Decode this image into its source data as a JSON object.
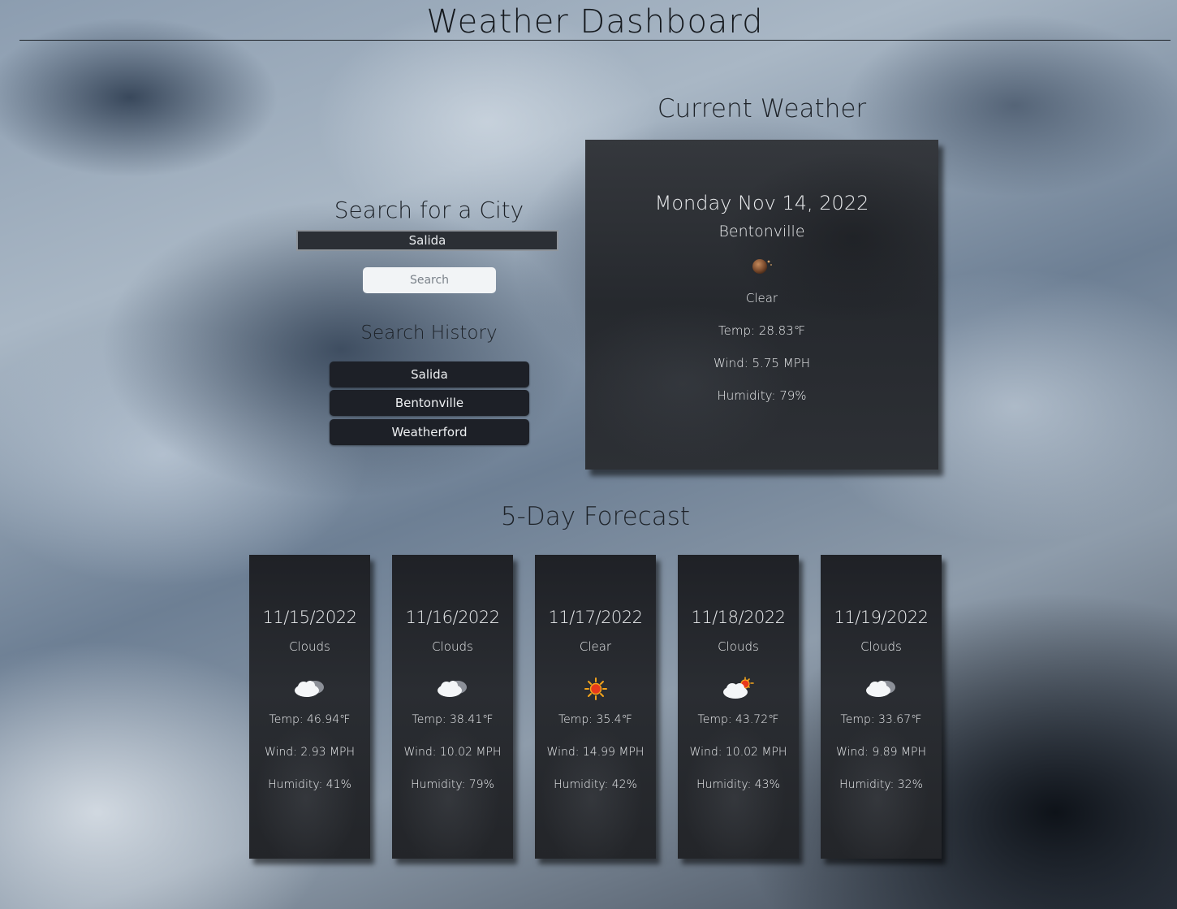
{
  "header": {
    "title": "Weather Dashboard"
  },
  "search": {
    "title": "Search for a City",
    "input_value": "Salida",
    "button_label": "Search"
  },
  "history": {
    "title": "Search History",
    "items": [
      "Salida",
      "Bentonville",
      "Weatherford"
    ]
  },
  "current": {
    "title": "Current Weather",
    "date": "Monday Nov 14, 2022",
    "city": "Bentonville",
    "icon": "moon-clear-icon",
    "condition": "Clear",
    "temp": "Temp: 28.83℉",
    "wind": "Wind: 5.75 MPH",
    "humidity": "Humidity: 79%"
  },
  "forecast": {
    "title": "5-Day Forecast",
    "days": [
      {
        "date": "11/15/2022",
        "condition": "Clouds",
        "icon": "cloud-icon",
        "temp": "Temp: 46.94℉",
        "wind": "Wind: 2.93 MPH",
        "humidity": "Humidity: 41%"
      },
      {
        "date": "11/16/2022",
        "condition": "Clouds",
        "icon": "cloud-icon",
        "temp": "Temp: 38.41℉",
        "wind": "Wind: 10.02 MPH",
        "humidity": "Humidity: 79%"
      },
      {
        "date": "11/17/2022",
        "condition": "Clear",
        "icon": "sun-icon",
        "temp": "Temp: 35.4℉",
        "wind": "Wind: 14.99 MPH",
        "humidity": "Humidity: 42%"
      },
      {
        "date": "11/18/2022",
        "condition": "Clouds",
        "icon": "cloud-sun-icon",
        "temp": "Temp: 43.72℉",
        "wind": "Wind: 10.02 MPH",
        "humidity": "Humidity: 43%"
      },
      {
        "date": "11/19/2022",
        "condition": "Clouds",
        "icon": "cloud-icon",
        "temp": "Temp: 33.67℉",
        "wind": "Wind: 9.89 MPH",
        "humidity": "Humidity: 32%"
      }
    ]
  }
}
